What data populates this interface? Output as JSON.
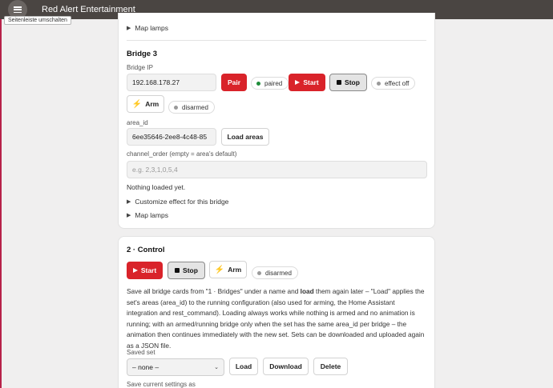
{
  "topbar": {
    "title": "Red Alert Entertainment",
    "menu_icon": "hamburger-menu-icon",
    "tooltip": "Seitenleiste umschalten"
  },
  "card1": {
    "map_lamps_top": "Map lamps",
    "bridge_title": "Bridge 3",
    "bridge_ip_label": "Bridge IP",
    "bridge_ip_value": "192.168.178.27",
    "pair_label": "Pair",
    "paired_status": "paired",
    "paired_color": "#1e8c3a",
    "start_label": "Start",
    "stop_label": "Stop",
    "effect_status": "effect off",
    "arm_label": "Arm",
    "disarmed_status": "disarmed",
    "neutral_dot_color": "#9a9a9a",
    "area_id_label": "area_id",
    "area_id_value": "6ee35646-2ee8-4c48-85",
    "load_areas_label": "Load areas",
    "channel_order_label": "channel_order (empty = area's default)",
    "channel_order_placeholder": "e.g. 2,3,1,0,5,4",
    "nothing_loaded": "Nothing loaded yet.",
    "customize_effect": "Customize effect for this bridge",
    "map_lamps_bottom": "Map lamps"
  },
  "card2": {
    "title": "2 · Control",
    "start_label": "Start",
    "stop_label": "Stop",
    "arm_label": "Arm",
    "disarmed_status": "disarmed",
    "desc_parts": [
      "Save all bridge cards from \"1 · Bridges\" under a name and ",
      "load",
      " them again later – \"Load\" applies the set's areas (area_id) to the running configuration (also used for arming, the Home Assistant integration and rest_command). Loading always works while nothing is armed and no animation is running; with an armed/running bridge only when the set has the same area_id per bridge – the animation then continues immediately with the new set. Sets can be downloaded and uploaded again as a JSON file."
    ],
    "saved_set_label": "Saved set",
    "saved_set_value": "– none –",
    "load_label": "Load",
    "download_label": "Download",
    "delete_label": "Delete",
    "save_current_label": "Save current settings as"
  },
  "colors": {
    "accent_red": "#d9232a",
    "topbar": "#4a4542"
  }
}
